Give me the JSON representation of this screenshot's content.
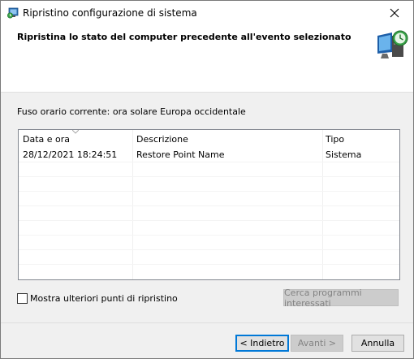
{
  "window": {
    "title": "Ripristino configurazione di sistema",
    "icon": "system-restore-icon",
    "close_icon": "close-icon"
  },
  "header": {
    "title": "Ripristina lo stato del computer precedente all'evento selezionato",
    "icon": "system-restore-monitor-icon"
  },
  "timezone_label": "Fuso orario corrente: ora solare Europa occidentale",
  "table": {
    "columns": [
      "Data e ora",
      "Descrizione",
      "Tipo"
    ],
    "sorted_column": "Data e ora",
    "rows": [
      {
        "date": "28/12/2021 18:24:51",
        "description": "Restore Point Name",
        "type": "Sistema"
      }
    ]
  },
  "more_points": {
    "label": "Mostra ulteriori punti di ripristino",
    "checked": false
  },
  "buttons": {
    "scan": "Cerca programmi interessati",
    "back": "< Indietro",
    "next": "Avanti >",
    "cancel": "Annulla"
  },
  "colors": {
    "accent": "#0078d7",
    "window_bg": "#f0f0f0",
    "header_bg": "#ffffff"
  }
}
